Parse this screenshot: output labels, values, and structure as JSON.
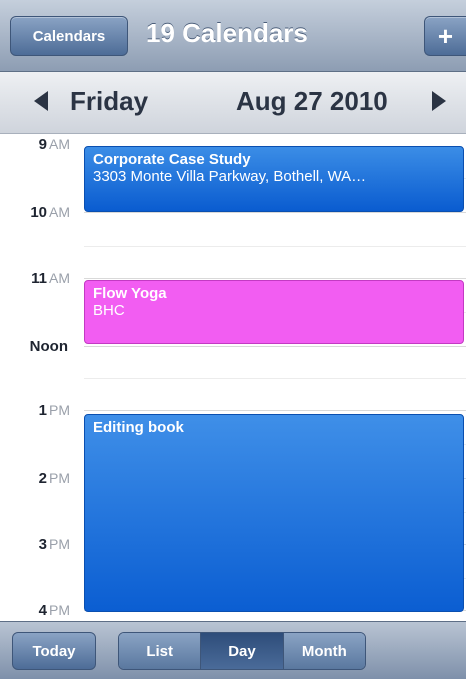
{
  "navbar": {
    "calendars_label": "Calendars",
    "title": "19 Calendars",
    "add_label": "+"
  },
  "datebar": {
    "day": "Friday",
    "date": "Aug 27 2010"
  },
  "hours": [
    {
      "num": "9",
      "suffix": "AM"
    },
    {
      "num": "10",
      "suffix": "AM"
    },
    {
      "num": "11",
      "suffix": "AM"
    },
    {
      "num": "Noon",
      "suffix": ""
    },
    {
      "num": "1",
      "suffix": "PM"
    },
    {
      "num": "2",
      "suffix": "PM"
    },
    {
      "num": "3",
      "suffix": "PM"
    },
    {
      "num": "4",
      "suffix": "PM"
    }
  ],
  "events": [
    {
      "title": "Corporate Case Study",
      "subtitle": "3303 Monte Villa Parkway, Bothell, WA…",
      "color": "#1a6fd9"
    },
    {
      "title": "Flow Yoga",
      "subtitle": "BHC",
      "color": "#f25df2"
    },
    {
      "title": "Editing book",
      "subtitle": "",
      "color": "#1a6fd9"
    }
  ],
  "toolbar": {
    "today_label": "Today",
    "segments": [
      "List",
      "Day",
      "Month"
    ],
    "active_segment": "Day"
  }
}
